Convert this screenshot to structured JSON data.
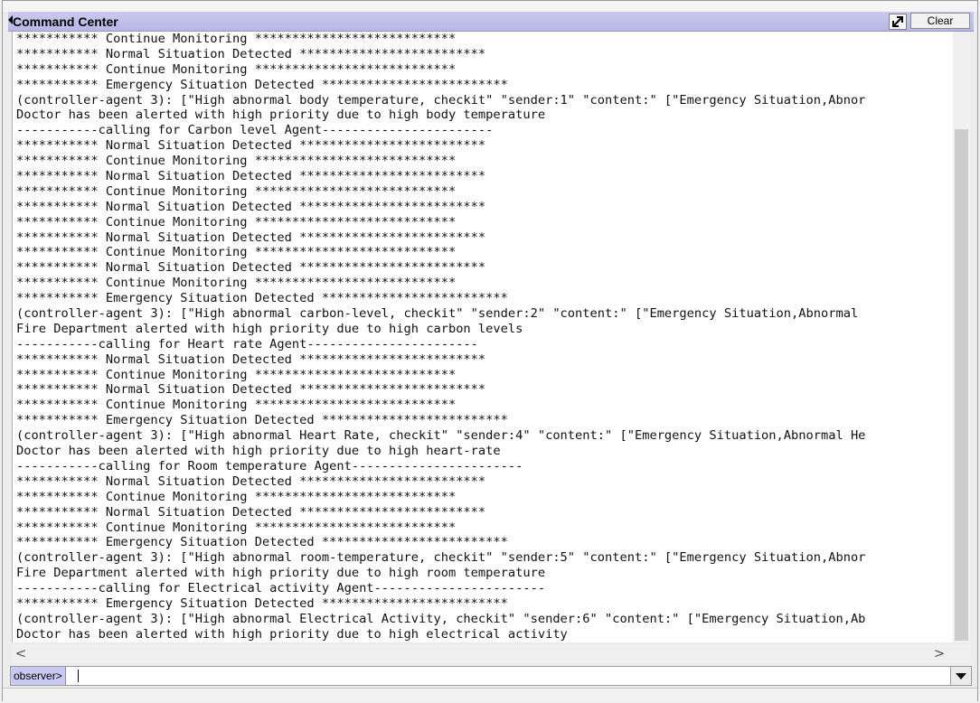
{
  "window": {
    "title": "Command Center",
    "clear_label": "Clear",
    "maximize_icon": "restore-arrow-icon"
  },
  "console": {
    "lines": [
      "*********** Continue Monitoring ***************************",
      "*********** Normal Situation Detected *************************",
      "*********** Continue Monitoring ***************************",
      "*********** Emergency Situation Detected *************************",
      "(controller-agent 3): [\"High abnormal body temperature, checkit\" \"sender:1\" \"content:\" [\"Emergency Situation,Abnor",
      "Doctor has been alerted with high priority due to high body temperature",
      "-----------calling for Carbon level Agent-----------------------",
      "*********** Normal Situation Detected *************************",
      "*********** Continue Monitoring ***************************",
      "*********** Normal Situation Detected *************************",
      "*********** Continue Monitoring ***************************",
      "*********** Normal Situation Detected *************************",
      "*********** Continue Monitoring ***************************",
      "*********** Normal Situation Detected *************************",
      "*********** Continue Monitoring ***************************",
      "*********** Normal Situation Detected *************************",
      "*********** Continue Monitoring ***************************",
      "*********** Emergency Situation Detected *************************",
      "(controller-agent 3): [\"High abnormal carbon-level, checkit\" \"sender:2\" \"content:\" [\"Emergency Situation,Abnormal",
      "Fire Department alerted with high priority due to high carbon levels",
      "-----------calling for Heart rate Agent-----------------------",
      "*********** Normal Situation Detected *************************",
      "*********** Continue Monitoring ***************************",
      "*********** Normal Situation Detected *************************",
      "*********** Continue Monitoring ***************************",
      "*********** Emergency Situation Detected *************************",
      "(controller-agent 3): [\"High abnormal Heart Rate, checkit\" \"sender:4\" \"content:\" [\"Emergency Situation,Abnormal He",
      "Doctor has been alerted with high priority due to high heart-rate",
      "-----------calling for Room temperature Agent-----------------------",
      "*********** Normal Situation Detected *************************",
      "*********** Continue Monitoring ***************************",
      "*********** Normal Situation Detected *************************",
      "*********** Continue Monitoring ***************************",
      "*********** Emergency Situation Detected *************************",
      "(controller-agent 3): [\"High abnormal room-temperature, checkit\" \"sender:5\" \"content:\" [\"Emergency Situation,Abnor",
      "Fire Department alerted with high priority due to high room temperature",
      "-----------calling for Electrical activity Agent-----------------------",
      "*********** Emergency Situation Detected *************************",
      "(controller-agent 3): [\"High abnormal Electrical Activity, checkit\" \"sender:6\" \"content:\" [\"Emergency Situation,Ab",
      "Doctor has been alerted with high priority due to high electrical activity"
    ]
  },
  "scroll": {
    "left_arrow": "<",
    "right_arrow": ">"
  },
  "command": {
    "prompt": "observer>",
    "value": "",
    "dropdown_icon": "chevron-down-icon"
  }
}
